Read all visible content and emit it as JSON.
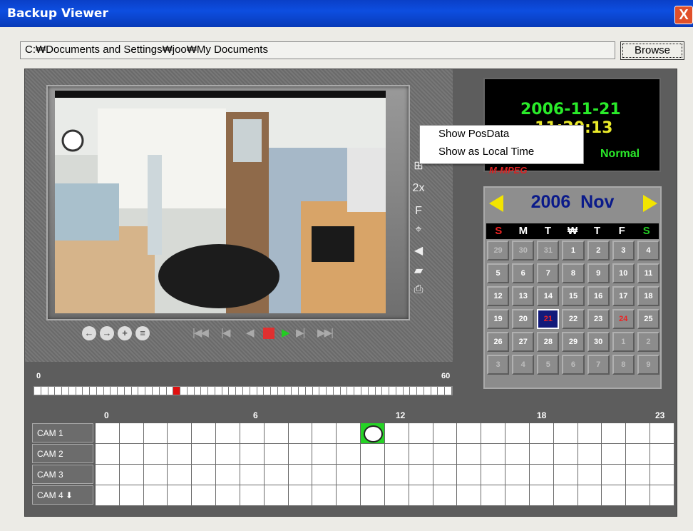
{
  "window": {
    "title": "Backup Viewer",
    "close_label": "X"
  },
  "path": {
    "value": "C:₩Documents and Settings₩joo₩My Documents",
    "browse_label": "Browse"
  },
  "side_controls": {
    "zoom_label": "2x",
    "full_label": "F"
  },
  "context_menu": {
    "items": [
      "Show PosData",
      "Show as Local Time"
    ]
  },
  "clock": {
    "date": "2006-11-21",
    "time": "11:20:13",
    "status": "Normal",
    "codec": "M-MPEG"
  },
  "calendar": {
    "year": "2006",
    "month": "Nov",
    "dow": [
      "S",
      "M",
      "T",
      "₩",
      "T",
      "F",
      "S"
    ],
    "days": [
      "29",
      "30",
      "31",
      "1",
      "2",
      "3",
      "4",
      "5",
      "6",
      "7",
      "8",
      "9",
      "10",
      "11",
      "12",
      "13",
      "14",
      "15",
      "16",
      "17",
      "18",
      "19",
      "20",
      "21",
      "22",
      "23",
      "24",
      "25",
      "26",
      "27",
      "28",
      "29",
      "30",
      "1",
      "2",
      "3",
      "4",
      "5",
      "6",
      "7",
      "8",
      "9"
    ],
    "selected_day": "21",
    "holiday_day": "24"
  },
  "minute_bar": {
    "start_label": "0",
    "end_label": "60",
    "marker_minute": 20
  },
  "hour_timeline": {
    "hour_labels": [
      "0",
      "6",
      "12",
      "18",
      "23"
    ],
    "cameras": [
      "CAM  1",
      "CAM  2",
      "CAM  3",
      "CAM  4"
    ],
    "recording": [
      {
        "camera": "CAM  1",
        "hour": 11
      }
    ]
  },
  "colors": {
    "accent": "#0a3fc7",
    "date_green": "#2aeb2a",
    "time_yellow": "#eaea2a",
    "selected_day_bg": "#131a7a"
  }
}
